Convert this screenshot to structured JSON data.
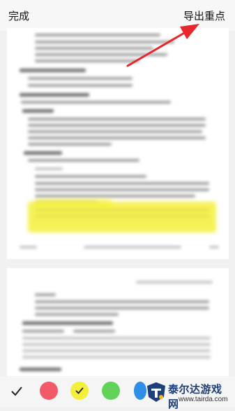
{
  "header": {
    "done_label": "完成",
    "export_label": "导出重点"
  },
  "palette": {
    "colors": [
      "#f25a6a",
      "#f4ef3a",
      "#62d25b",
      "#2f8ee8"
    ],
    "selected": "#f4ef3a"
  },
  "watermark": {
    "brand": "泰尔达游戏网",
    "domain": "www.tairda.com"
  }
}
